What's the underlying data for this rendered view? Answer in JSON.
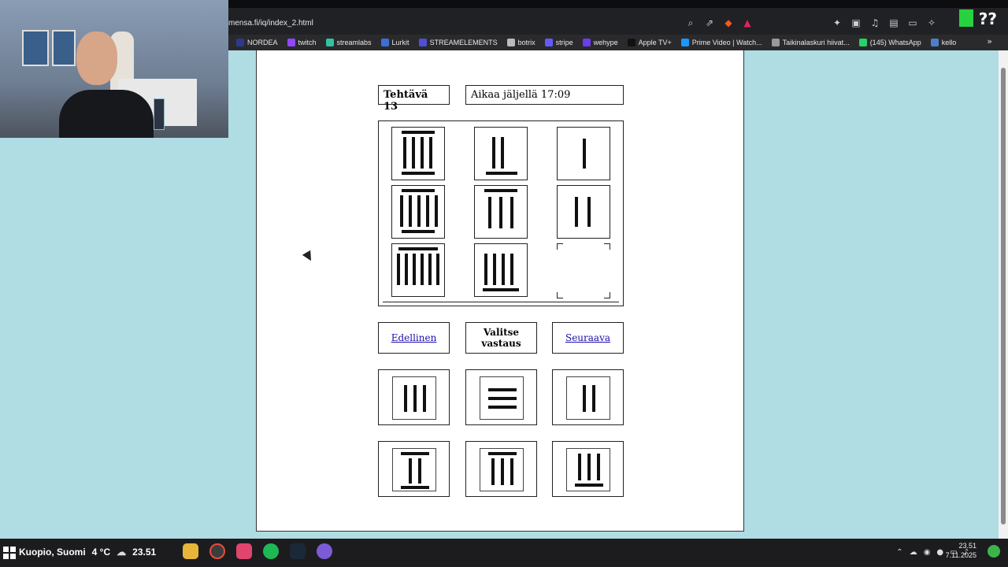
{
  "browser": {
    "url": "mensa.fi/iq/index_2.html",
    "bookmarks": [
      "NORDEA",
      "twitch",
      "streamlabs",
      "Lurkit",
      "STREAMELEMENTS",
      "botrix",
      "stripe",
      "wehype",
      "Apple TV+",
      "Prime Video | Watch...",
      "Taikinalaskuri hiivat...",
      "(145) WhatsApp",
      "kello"
    ],
    "more_label": "»"
  },
  "overlay": {
    "badge_text": "??"
  },
  "quiz": {
    "task_label": "Tehtävä 13",
    "timer_label": "Aikaa jäljellä 17:09",
    "prev_label": "Edellinen",
    "choose_label_1": "Valitse",
    "choose_label_2": "vastaus",
    "next_label": "Seuraava"
  },
  "taskbar": {
    "location": "Kuopio, Suomi",
    "temp": "4 °C",
    "time_left": "23.51",
    "clock_time": "23.51",
    "clock_date": "7.11.2025"
  }
}
